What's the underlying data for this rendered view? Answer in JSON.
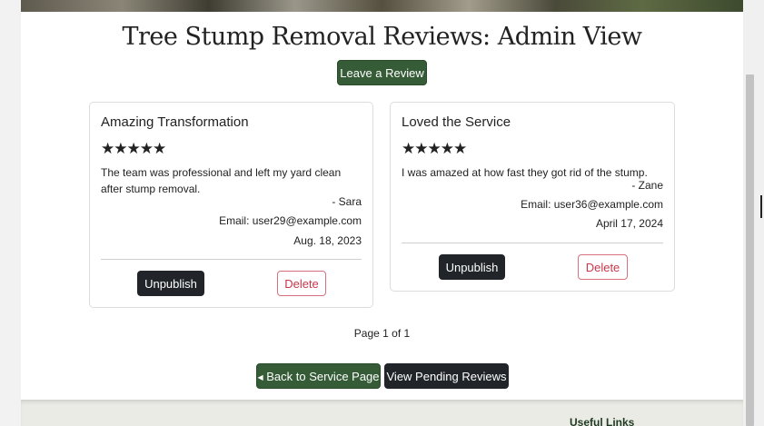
{
  "page": {
    "title": "Tree Stump Removal Reviews: Admin View",
    "leave_review_label": "Leave a Review"
  },
  "reviews": [
    {
      "title": "Amazing Transformation",
      "rating": 5,
      "stars": "★★★★★",
      "body": "The team was professional and left my yard clean after stump removal.",
      "author": "- Sara",
      "email": "Email: user29@example.com",
      "date": "Aug. 18, 2023",
      "unpublish_label": "Unpublish",
      "delete_label": "Delete"
    },
    {
      "title": "Loved the Service",
      "rating": 5,
      "stars": "★★★★★",
      "body": "I was amazed at how fast they got rid of the stump.",
      "author": "- Zane",
      "email": "Email: user36@example.com",
      "date": "April 17, 2024",
      "unpublish_label": "Unpublish",
      "delete_label": "Delete"
    }
  ],
  "pagination": {
    "text": "Page 1 of 1"
  },
  "nav": {
    "back_label": "Back to Service Page",
    "back_icon": "caret-left-icon",
    "pending_label": "View Pending Reviews"
  },
  "footer": {
    "useful_links_heading": "Useful Links"
  },
  "colors": {
    "primary_green": "#355c37",
    "dark": "#212529",
    "danger": "#c8364a"
  }
}
